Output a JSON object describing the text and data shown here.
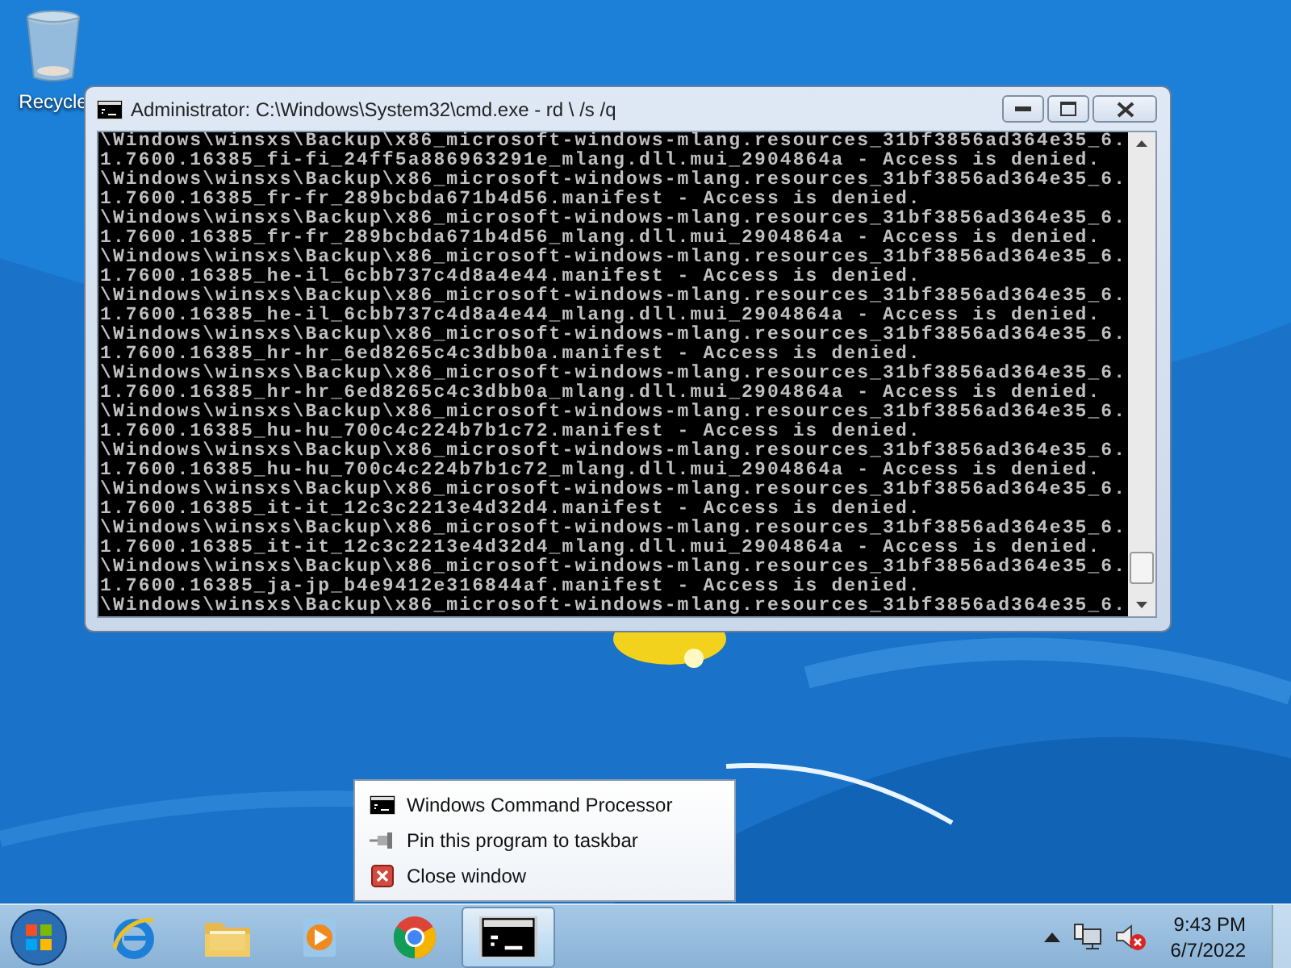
{
  "desktop": {
    "icons": [
      {
        "label": "Recycle"
      }
    ]
  },
  "window": {
    "title": "Administrator: C:\\Windows\\System32\\cmd.exe - rd \\ /s /q",
    "console_lines": [
      "\\Windows\\winsxs\\Backup\\x86_microsoft-windows-mlang.resources_31bf3856ad364e35_6.",
      "1.7600.16385_fi-fi_24ff5a886963291e_mlang.dll.mui_2904864a - Access is denied.",
      "\\Windows\\winsxs\\Backup\\x86_microsoft-windows-mlang.resources_31bf3856ad364e35_6.",
      "1.7600.16385_fr-fr_289bcbda671b4d56.manifest - Access is denied.",
      "\\Windows\\winsxs\\Backup\\x86_microsoft-windows-mlang.resources_31bf3856ad364e35_6.",
      "1.7600.16385_fr-fr_289bcbda671b4d56_mlang.dll.mui_2904864a - Access is denied.",
      "\\Windows\\winsxs\\Backup\\x86_microsoft-windows-mlang.resources_31bf3856ad364e35_6.",
      "1.7600.16385_he-il_6cbb737c4d8a4e44.manifest - Access is denied.",
      "\\Windows\\winsxs\\Backup\\x86_microsoft-windows-mlang.resources_31bf3856ad364e35_6.",
      "1.7600.16385_he-il_6cbb737c4d8a4e44_mlang.dll.mui_2904864a - Access is denied.",
      "\\Windows\\winsxs\\Backup\\x86_microsoft-windows-mlang.resources_31bf3856ad364e35_6.",
      "1.7600.16385_hr-hr_6ed8265c4c3dbb0a.manifest - Access is denied.",
      "\\Windows\\winsxs\\Backup\\x86_microsoft-windows-mlang.resources_31bf3856ad364e35_6.",
      "1.7600.16385_hr-hr_6ed8265c4c3dbb0a_mlang.dll.mui_2904864a - Access is denied.",
      "\\Windows\\winsxs\\Backup\\x86_microsoft-windows-mlang.resources_31bf3856ad364e35_6.",
      "1.7600.16385_hu-hu_700c4c224b7b1c72.manifest - Access is denied.",
      "\\Windows\\winsxs\\Backup\\x86_microsoft-windows-mlang.resources_31bf3856ad364e35_6.",
      "1.7600.16385_hu-hu_700c4c224b7b1c72_mlang.dll.mui_2904864a - Access is denied.",
      "\\Windows\\winsxs\\Backup\\x86_microsoft-windows-mlang.resources_31bf3856ad364e35_6.",
      "1.7600.16385_it-it_12c3c2213e4d32d4.manifest - Access is denied.",
      "\\Windows\\winsxs\\Backup\\x86_microsoft-windows-mlang.resources_31bf3856ad364e35_6.",
      "1.7600.16385_it-it_12c3c2213e4d32d4_mlang.dll.mui_2904864a - Access is denied.",
      "\\Windows\\winsxs\\Backup\\x86_microsoft-windows-mlang.resources_31bf3856ad364e35_6.",
      "1.7600.16385_ja-jp_b4e9412e316844af.manifest - Access is denied.",
      "\\Windows\\winsxs\\Backup\\x86_microsoft-windows-mlang.resources_31bf3856ad364e35_6."
    ]
  },
  "jump_list": {
    "items": [
      {
        "kind": "app",
        "label": "Windows Command Processor"
      },
      {
        "kind": "pin",
        "label": "Pin this program to taskbar"
      },
      {
        "kind": "close",
        "label": "Close window"
      }
    ]
  },
  "taskbar": {
    "apps": [
      {
        "kind": "ie",
        "active": false
      },
      {
        "kind": "explorer",
        "active": false
      },
      {
        "kind": "media",
        "active": false
      },
      {
        "kind": "chrome",
        "active": false
      },
      {
        "kind": "cmd",
        "active": true
      }
    ],
    "clock": {
      "time": "9:43 PM",
      "date": "6/7/2022"
    }
  }
}
